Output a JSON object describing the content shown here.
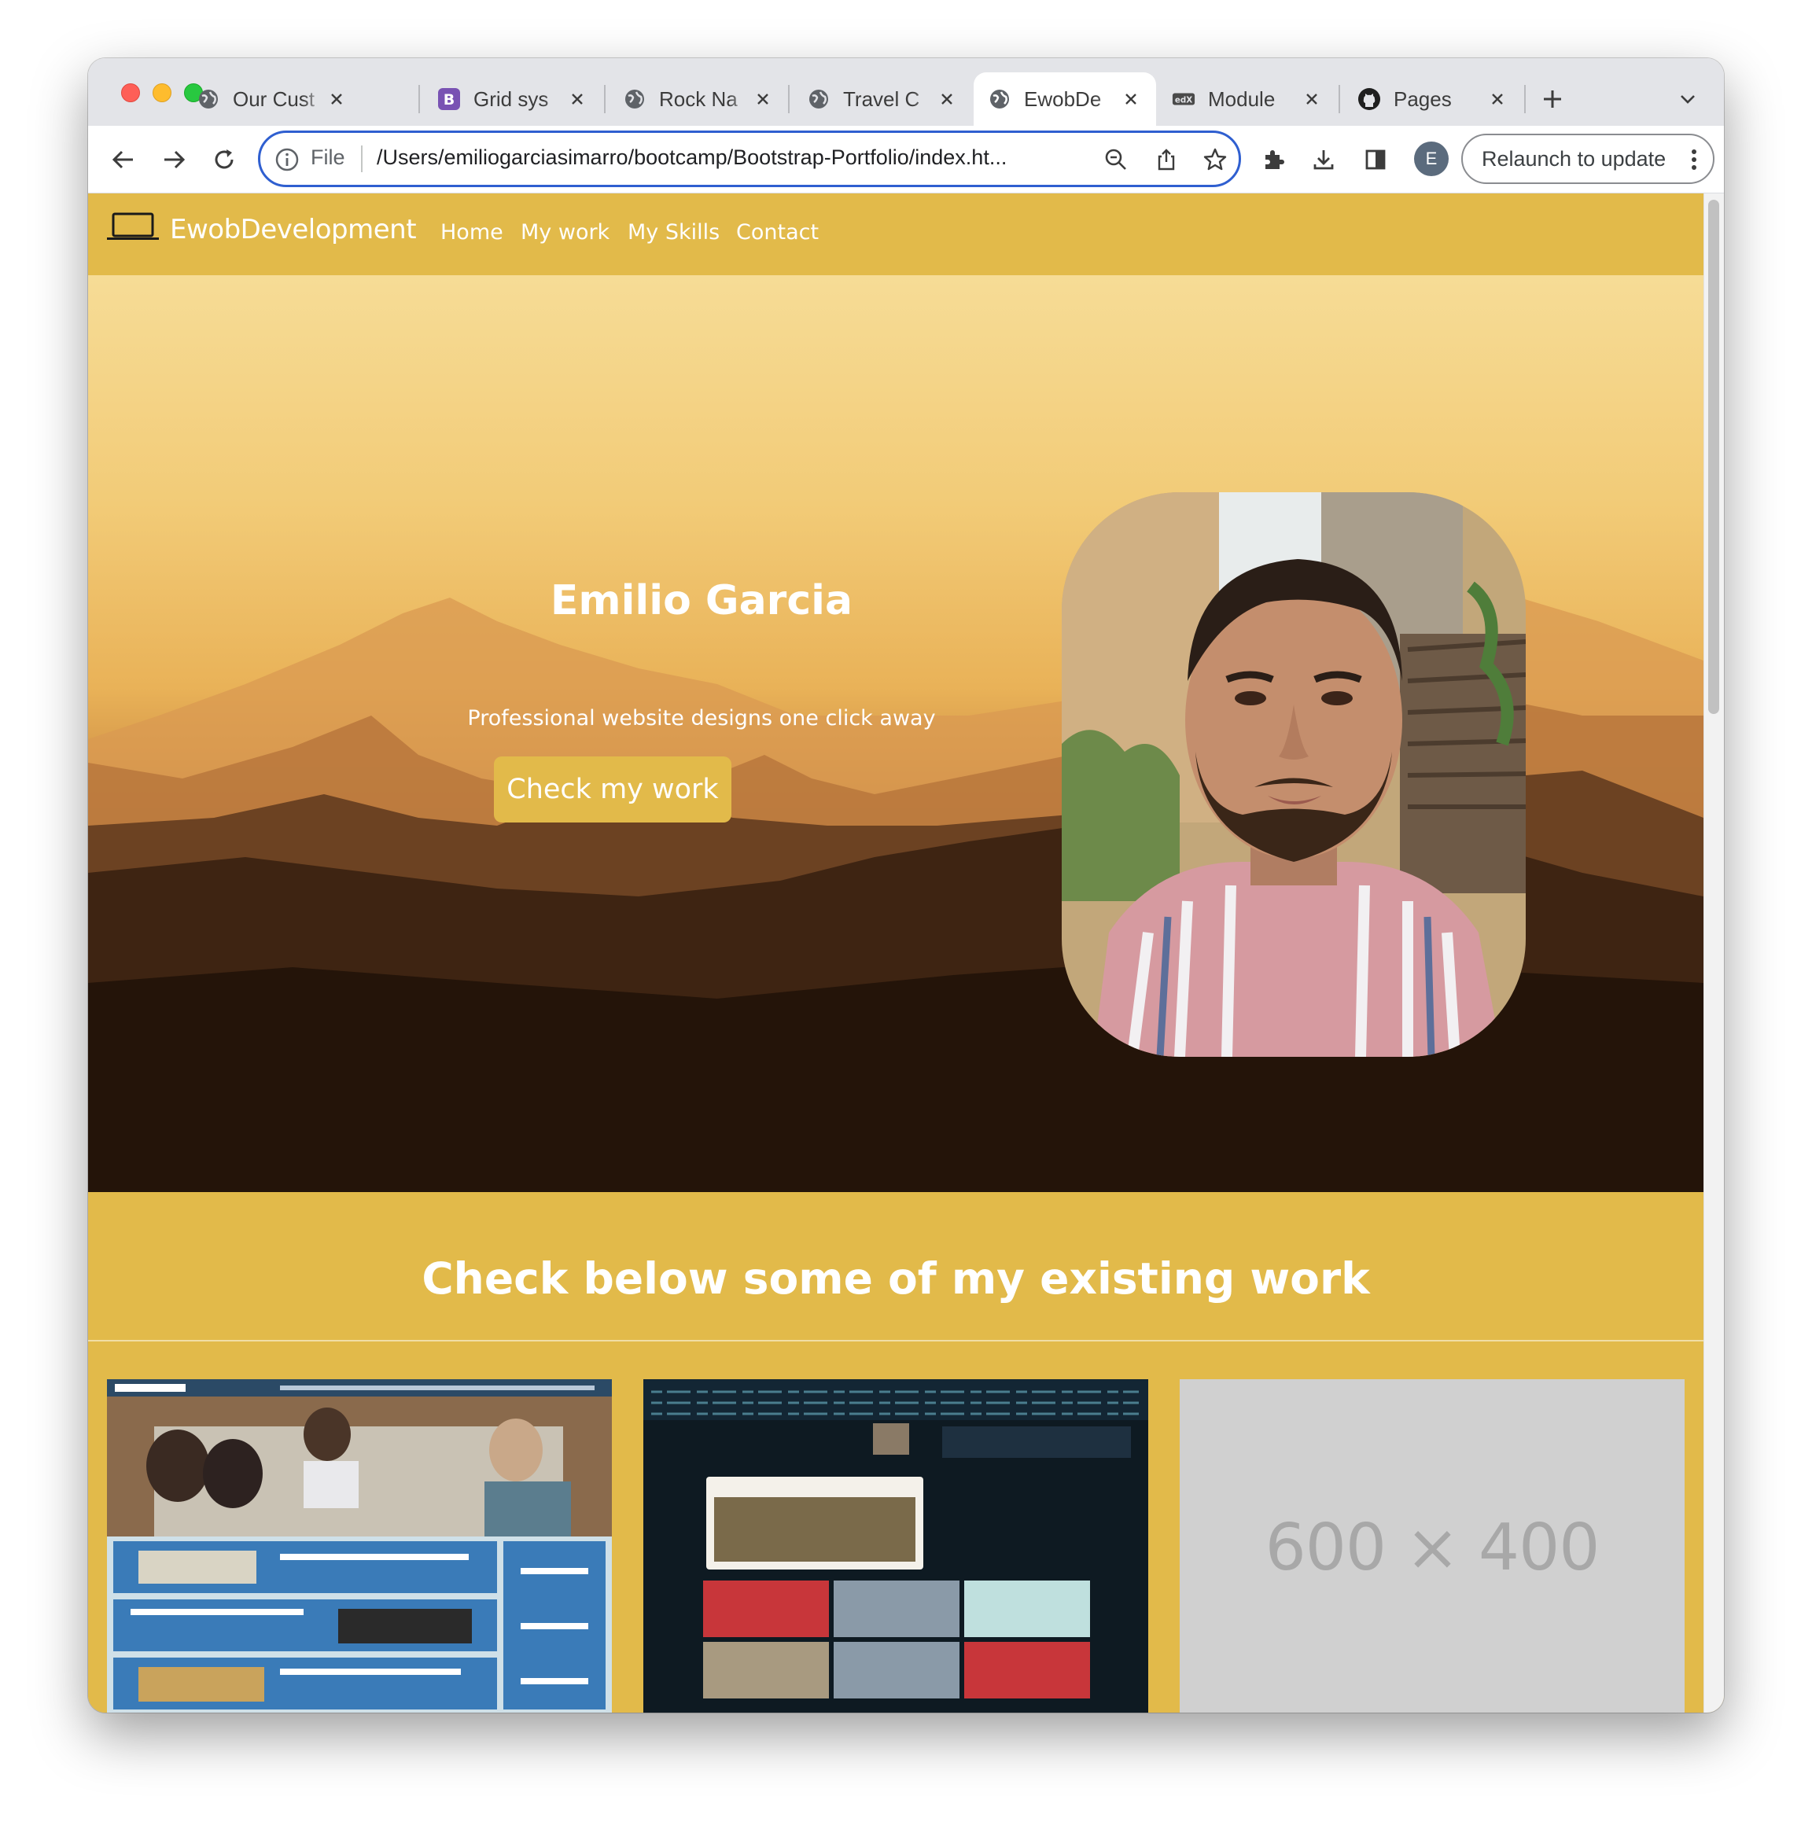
{
  "browser": {
    "tabs": [
      {
        "title": "Our Cust",
        "icon": "globe-icon",
        "active": false
      },
      {
        "title": "Grid sys",
        "icon": "bootstrap-icon",
        "active": false
      },
      {
        "title": "Rock Na",
        "icon": "globe-icon",
        "active": false
      },
      {
        "title": "Travel C",
        "icon": "globe-icon",
        "active": false
      },
      {
        "title": "EwobDe",
        "icon": "globe-icon",
        "active": true
      },
      {
        "title": "Module",
        "icon": "edx-icon",
        "active": false
      },
      {
        "title": "Pages",
        "icon": "github-icon",
        "active": false
      }
    ],
    "omnibox": {
      "scheme_label": "File",
      "url": "/Users/emiliogarciasimarro/bootcamp/Bootstrap-Portfolio/index.ht..."
    },
    "profile_initial": "E",
    "relaunch_label": "Relaunch to update",
    "accent_color": "#2f5fd0"
  },
  "site": {
    "brand": "EwobDevelopment",
    "nav": [
      "Home",
      "My work",
      "My Skills",
      "Contact"
    ],
    "theme_color": "#e2ba4a",
    "hero": {
      "name": "Emilio Garcia",
      "tagline": "Professional website designs one click away",
      "cta": "Check my work"
    },
    "work": {
      "heading": "Check below some of my existing work",
      "placeholder": "600 × 400"
    }
  }
}
